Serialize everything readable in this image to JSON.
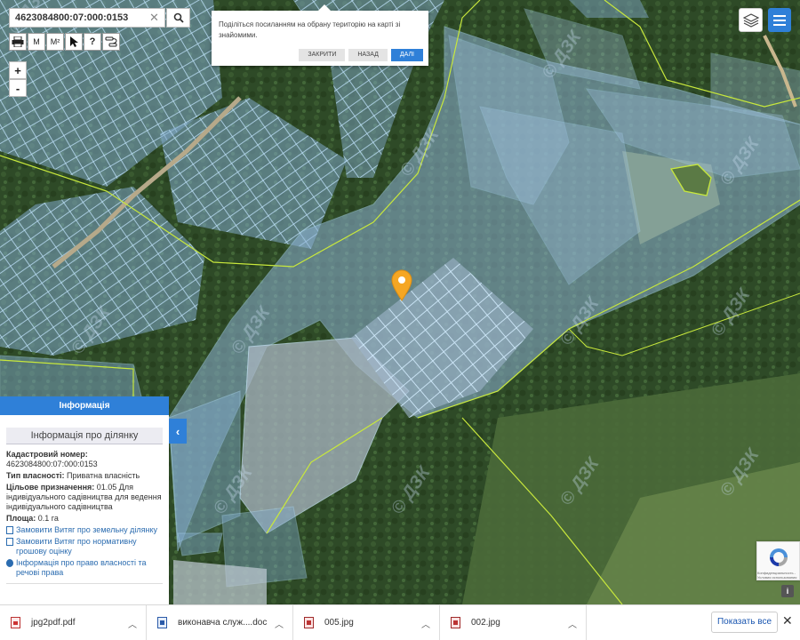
{
  "search": {
    "value": "4623084800:07:000:0153",
    "clear_icon": "✕",
    "button_icon": "search-icon"
  },
  "tools": [
    {
      "name": "print-icon",
      "label": ""
    },
    {
      "name": "measure-length-icon",
      "label": "M"
    },
    {
      "name": "measure-area-icon",
      "label": "M²"
    },
    {
      "name": "select-pointer-icon",
      "label": ""
    },
    {
      "name": "identify-icon",
      "label": "?"
    },
    {
      "name": "route-icon",
      "label": ""
    }
  ],
  "zoom": {
    "in": "+",
    "out": "-"
  },
  "share": {
    "text": "Поділіться посиланням на обрану територію на карті зі знайомими.",
    "close_label": "Закрити",
    "back_label": "Назад",
    "next_label": "Далі"
  },
  "info_panel": {
    "header": "Інформація",
    "subheader": "Інформація про ділянку",
    "cadastral_label": "Кадастровий номер:",
    "cadastral_value": "4623084800:07:000:0153",
    "ownership_label": "Тип власності:",
    "ownership_value": "Приватна власність",
    "purpose_label": "Цільове призначення:",
    "purpose_value": "01.05 Для індивідуального садівництва для ведення індивідуального садівництва",
    "area_label": "Площа:",
    "area_value": "0.1 га",
    "links": [
      "Замовити Витяг про земельну ділянку",
      "Замовити Витяг про нормативну грошову оцінку",
      "Інформація про право власності та речові права"
    ],
    "collapse_icon": "‹"
  },
  "watermark": "© ДЗК",
  "downloads": {
    "items": [
      {
        "name": "jpg2pdf.pdf",
        "type": "pdf"
      },
      {
        "name": "виконавча служ....doc",
        "type": "doc"
      },
      {
        "name": "005.jpg",
        "type": "jpg"
      },
      {
        "name": "002.jpg",
        "type": "jpg"
      }
    ],
    "show_all": "Показать все",
    "close": "✕"
  },
  "recaptcha": {
    "text": "Конфиденциальность - Условия использования"
  },
  "info_icon": "i",
  "colors": {
    "accent": "#2f80d8",
    "parcel_fill": "#7fa8c8",
    "parcel_stroke": "#a8d4f0",
    "boundary": "#c8e83c",
    "marker": "#f5a623"
  }
}
